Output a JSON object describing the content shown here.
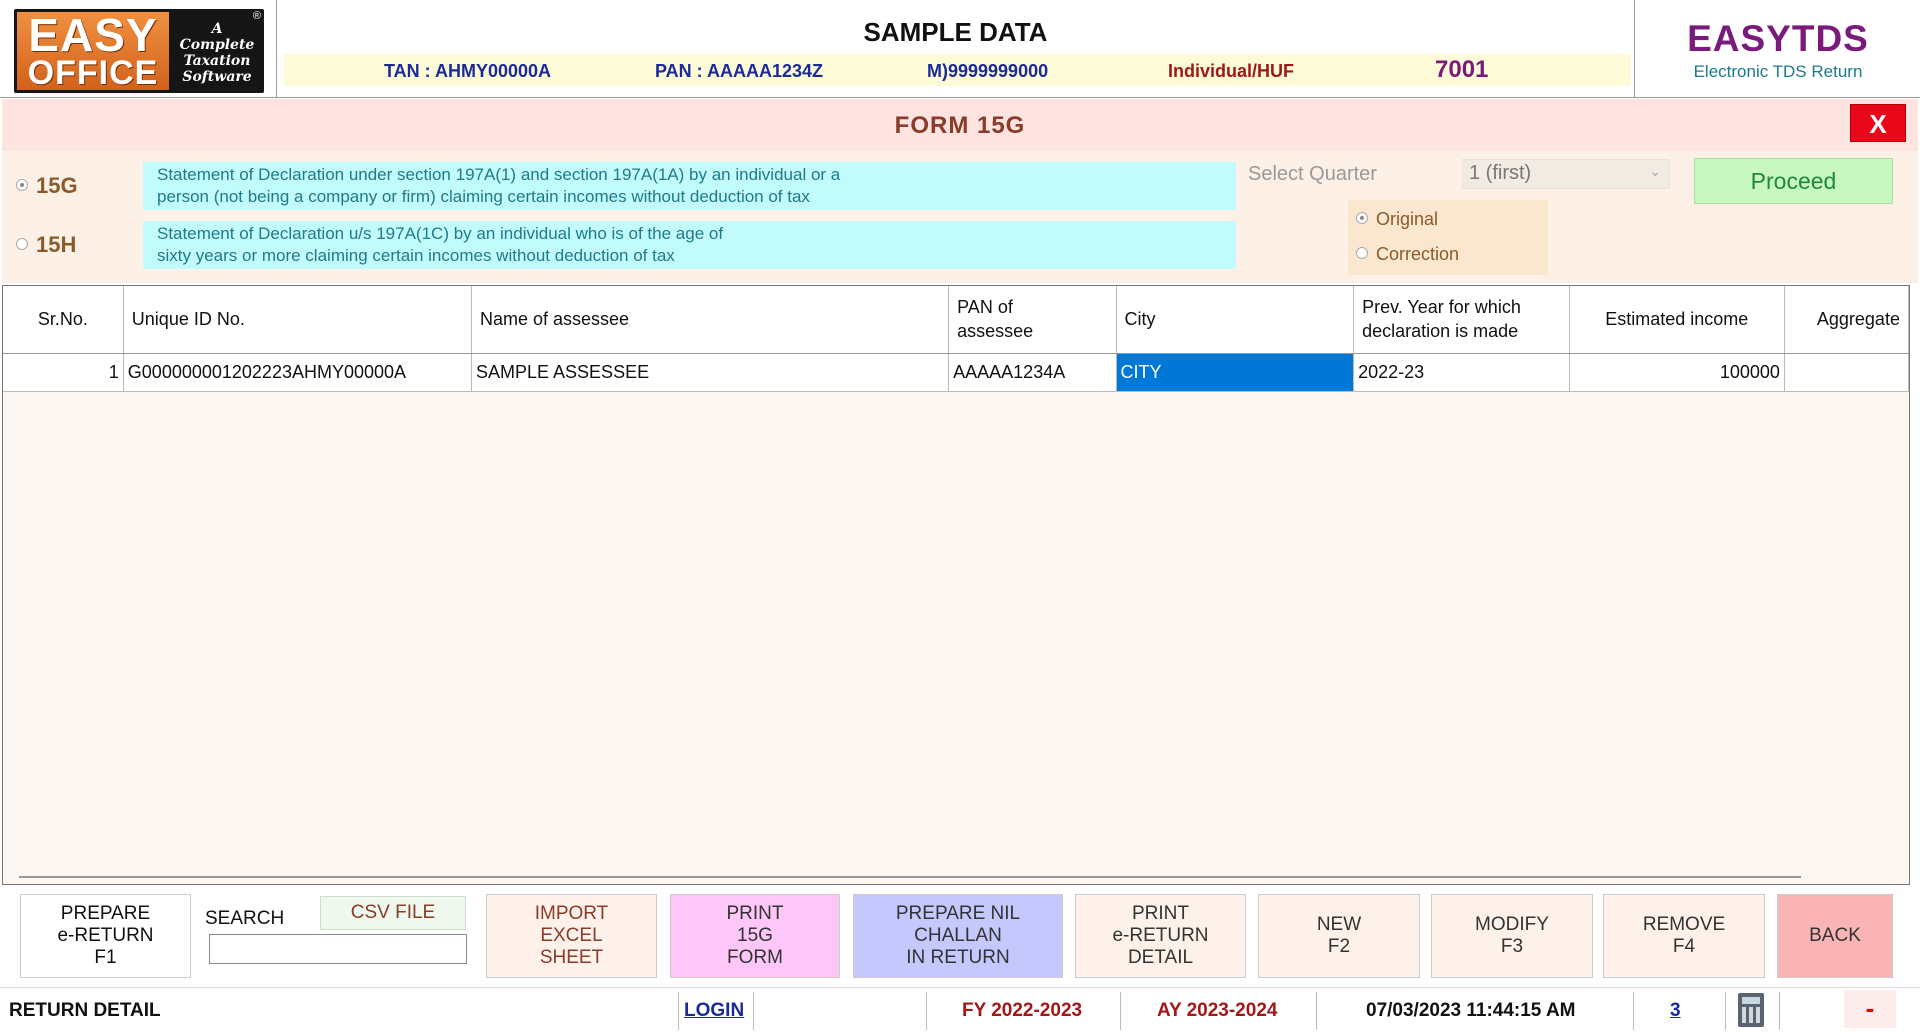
{
  "logo": {
    "line1": "EASY",
    "line2": "OFFICE",
    "tagline": "A Complete Taxation Software",
    "reg": "®"
  },
  "header": {
    "company": "SAMPLE DATA",
    "tan": "TAN : AHMY00000A",
    "pan": "PAN : AAAAA1234Z",
    "mobile": "M)9999999000",
    "status": "Individual/HUF",
    "code": "7001",
    "colors": {
      "info": "#1a2a9a",
      "status": "#a01818",
      "code": "#7a1a7a"
    }
  },
  "brand": {
    "title": "EASYTDS",
    "subtitle": "Electronic TDS Return"
  },
  "form": {
    "title": "FORM 15G",
    "close_label": "X"
  },
  "options": {
    "form15g": {
      "label": "15G",
      "selected": true,
      "description": "Statement of Declaration under section 197A(1) and section 197A(1A) by an individual or a\nperson (not being a company or firm) claiming certain incomes without deduction of tax"
    },
    "form15h": {
      "label": "15H",
      "selected": false,
      "description": "Statement of Declaration u/s 197A(1C) by an individual who is of the age of\nsixty years or more claiming certain incomes without deduction of tax"
    },
    "quarter_label": "Select Quarter",
    "quarter_value": "1 (first)",
    "proceed_label": "Proceed",
    "original_label": "Original",
    "correction_label": "Correction"
  },
  "table": {
    "headers": [
      "Sr.No.",
      "Unique ID No.",
      "Name of assessee",
      "PAN of\nassessee",
      "City",
      "Prev. Year for which\ndeclaration is made",
      "Estimated income",
      "Aggregate"
    ],
    "rows": [
      [
        "1",
        "G000000001202223AHMY00000A",
        "SAMPLE ASSESSEE",
        "AAAAA1234A",
        "CITY",
        "2022-23",
        "100000",
        ""
      ]
    ]
  },
  "toolbar": {
    "prepare_return": "PREPARE\ne-RETURN\nF1",
    "search_label": "SEARCH",
    "csv_label": "CSV FILE",
    "import_excel": "IMPORT\nEXCEL\nSHEET",
    "print_form": "PRINT\n15G\nFORM",
    "prepare_nil": "PREPARE NIL\nCHALLAN\nIN RETURN",
    "print_detail": "PRINT\ne-RETURN\nDETAIL",
    "new": "NEW\nF2",
    "modify": "MODIFY\nF3",
    "remove": "REMOVE\nF4",
    "back": "BACK"
  },
  "statusbar": {
    "section": "RETURN DETAIL",
    "login": "LOGIN",
    "fy": "FY 2022-2023",
    "ay": "AY 2023-2024",
    "datetime": "07/03/2023 11:44:15 AM",
    "count": "3",
    "minimize": "-"
  }
}
